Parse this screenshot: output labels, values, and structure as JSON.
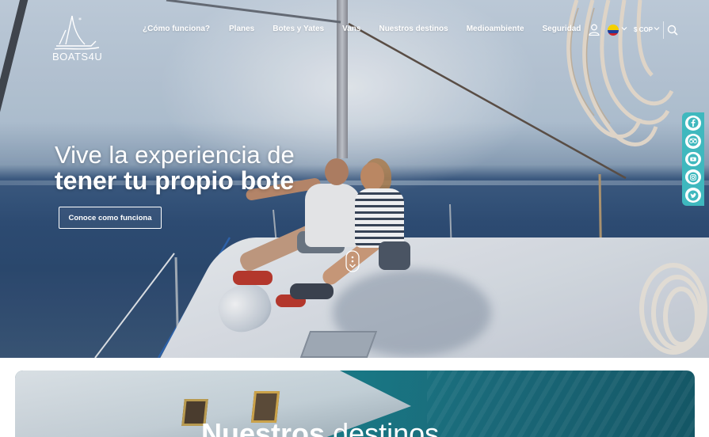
{
  "brand": {
    "name": "BOATS4U"
  },
  "nav": {
    "items": [
      {
        "label": "¿Cómo funciona?"
      },
      {
        "label": "Planes"
      },
      {
        "label": "Botes y Yates"
      },
      {
        "label": "Vans"
      },
      {
        "label": "Nuestros destinos"
      },
      {
        "label": "Medioambiente"
      },
      {
        "label": "Seguridad"
      }
    ],
    "currency": "$ COP",
    "country_flag": "colombia-flag-icon"
  },
  "hero": {
    "title_line1": "Vive la experiencia de",
    "title_line2": "tener tu propio bote",
    "cta_label": "Conoce como funciona"
  },
  "social": {
    "icons": [
      "facebook-icon",
      "tripadvisor-icon",
      "youtube-icon",
      "instagram-icon",
      "twitter-icon"
    ],
    "accent_color": "#3fb8be"
  },
  "destinations": {
    "title_bold": "Nuestros",
    "title_light": "destinos"
  }
}
